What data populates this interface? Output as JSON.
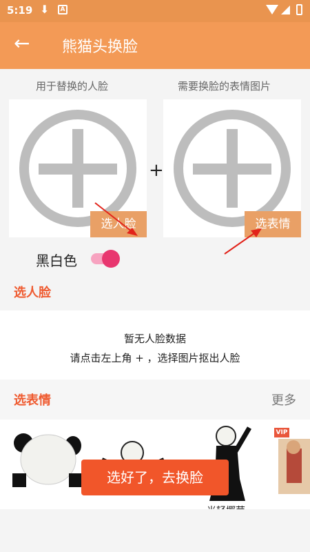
{
  "status_bar": {
    "time": "5:19",
    "download_glyph": "⬇",
    "notif_glyph": "A"
  },
  "app_bar": {
    "back_glyph": "←",
    "title": "熊猫头换脸"
  },
  "pick_face": {
    "label": "用于替换的人脸",
    "button": "选人脸"
  },
  "pick_expression": {
    "label": "需要换脸的表情图片",
    "button": "选表情"
  },
  "join_symbol": "+",
  "bw_toggle": {
    "label": "黑白色",
    "on": true
  },
  "face_section": {
    "title": "选人脸"
  },
  "no_data": {
    "line1": "暂无人脸数据",
    "line2": "请点击左上角 + ，选择图片抠出人脸"
  },
  "expression_section": {
    "title": "选表情",
    "more": "更多"
  },
  "thumbnails": {
    "vip_badge": "VIP",
    "caption": "光轻揶芽"
  },
  "go_button": "选好了，去换脸",
  "colors": {
    "app_bar": "#f39a56",
    "accent": "#ef5a2f",
    "button": "#f1562a",
    "pick_button": "#e9a066",
    "toggle": "#e8366f"
  }
}
